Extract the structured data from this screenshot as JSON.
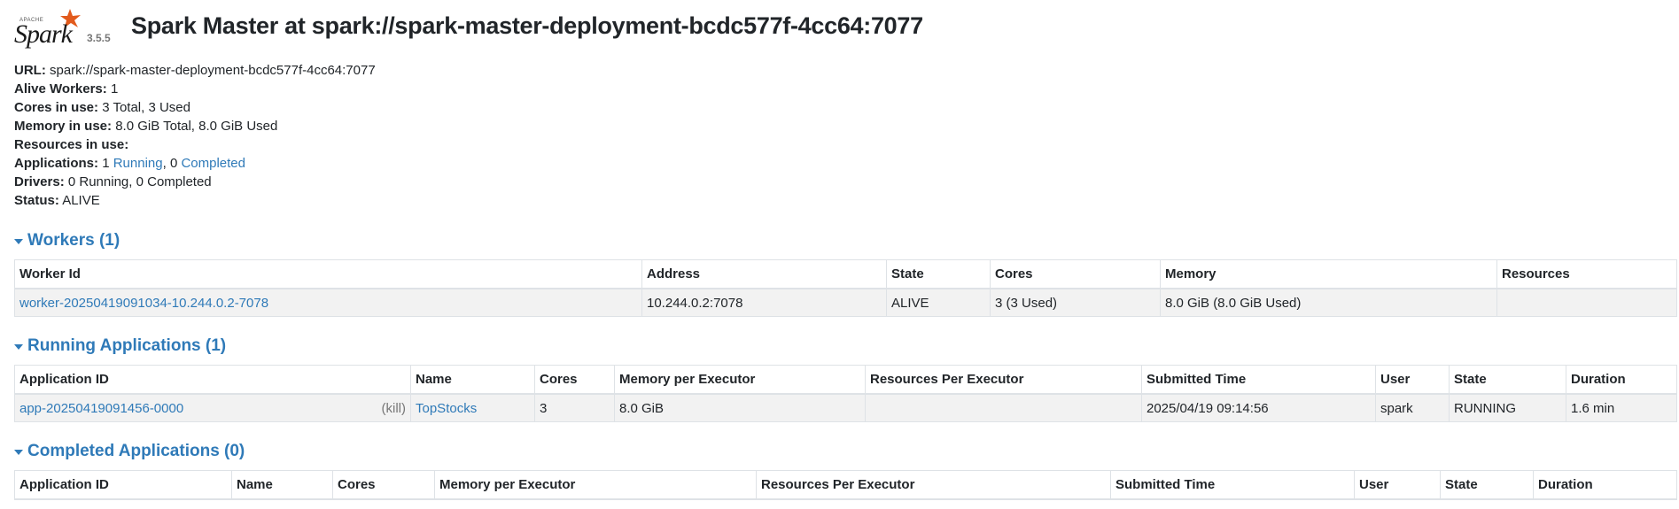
{
  "header": {
    "logo_apache": "APACHE",
    "logo_text": "Spark",
    "version": "3.5.5",
    "title": "Spark Master at spark://spark-master-deployment-bcdc577f-4cc64:7077"
  },
  "summary": {
    "url_label": "URL:",
    "url_value": "spark://spark-master-deployment-bcdc577f-4cc64:7077",
    "alive_workers_label": "Alive Workers:",
    "alive_workers_value": "1",
    "cores_label": "Cores in use:",
    "cores_value": "3 Total, 3 Used",
    "memory_label": "Memory in use:",
    "memory_value": "8.0 GiB Total, 8.0 GiB Used",
    "resources_label": "Resources in use:",
    "applications_label": "Applications:",
    "applications_running_count": "1",
    "applications_running_link": "Running",
    "applications_sep": ",",
    "applications_completed_count": "0",
    "applications_completed_link": "Completed",
    "drivers_label": "Drivers:",
    "drivers_value": "0 Running, 0 Completed",
    "status_label": "Status:",
    "status_value": "ALIVE"
  },
  "workers": {
    "heading": "Workers (1)",
    "columns": [
      "Worker Id",
      "Address",
      "State",
      "Cores",
      "Memory",
      "Resources"
    ],
    "rows": [
      {
        "worker_id": "worker-20250419091034-10.244.0.2-7078",
        "address": "10.244.0.2:7078",
        "state": "ALIVE",
        "cores": "3 (3 Used)",
        "memory": "8.0 GiB (8.0 GiB Used)",
        "resources": ""
      }
    ]
  },
  "running_apps": {
    "heading": "Running Applications (1)",
    "columns": [
      "Application ID",
      "Name",
      "Cores",
      "Memory per Executor",
      "Resources Per Executor",
      "Submitted Time",
      "User",
      "State",
      "Duration"
    ],
    "rows": [
      {
        "app_id": "app-20250419091456-0000",
        "kill": "(kill)",
        "name": "TopStocks",
        "cores": "3",
        "memory_per_executor": "8.0 GiB",
        "resources_per_executor": "",
        "submitted_time": "2025/04/19 09:14:56",
        "user": "spark",
        "state": "RUNNING",
        "duration": "1.6 min"
      }
    ]
  },
  "completed_apps": {
    "heading": "Completed Applications (0)",
    "columns": [
      "Application ID",
      "Name",
      "Cores",
      "Memory per Executor",
      "Resources Per Executor",
      "Submitted Time",
      "User",
      "State",
      "Duration"
    ]
  },
  "colors": {
    "link": "#2f7ab8",
    "row_background": "#f2f2f2",
    "logo_star": "#e25a1c"
  }
}
